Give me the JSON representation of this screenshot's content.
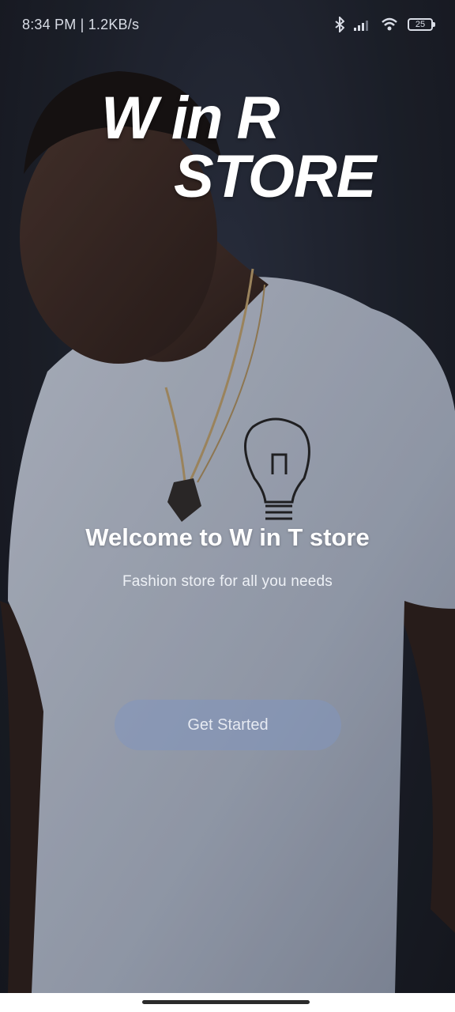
{
  "status_bar": {
    "time_speed": "8:34 PM | 1.2KB/s",
    "battery_level": "25",
    "icons": [
      "bluetooth-icon",
      "signal-icon",
      "wifi-icon",
      "battery-icon"
    ]
  },
  "logo": {
    "line1": "W in R",
    "line2": "STORE"
  },
  "welcome": {
    "title": "Welcome to W in T store",
    "subtitle": "Fashion store for all you needs"
  },
  "actions": {
    "get_started_label": "Get Started"
  },
  "colors": {
    "background": "#1c2029",
    "button": "#8296be",
    "text": "#ffffff"
  }
}
